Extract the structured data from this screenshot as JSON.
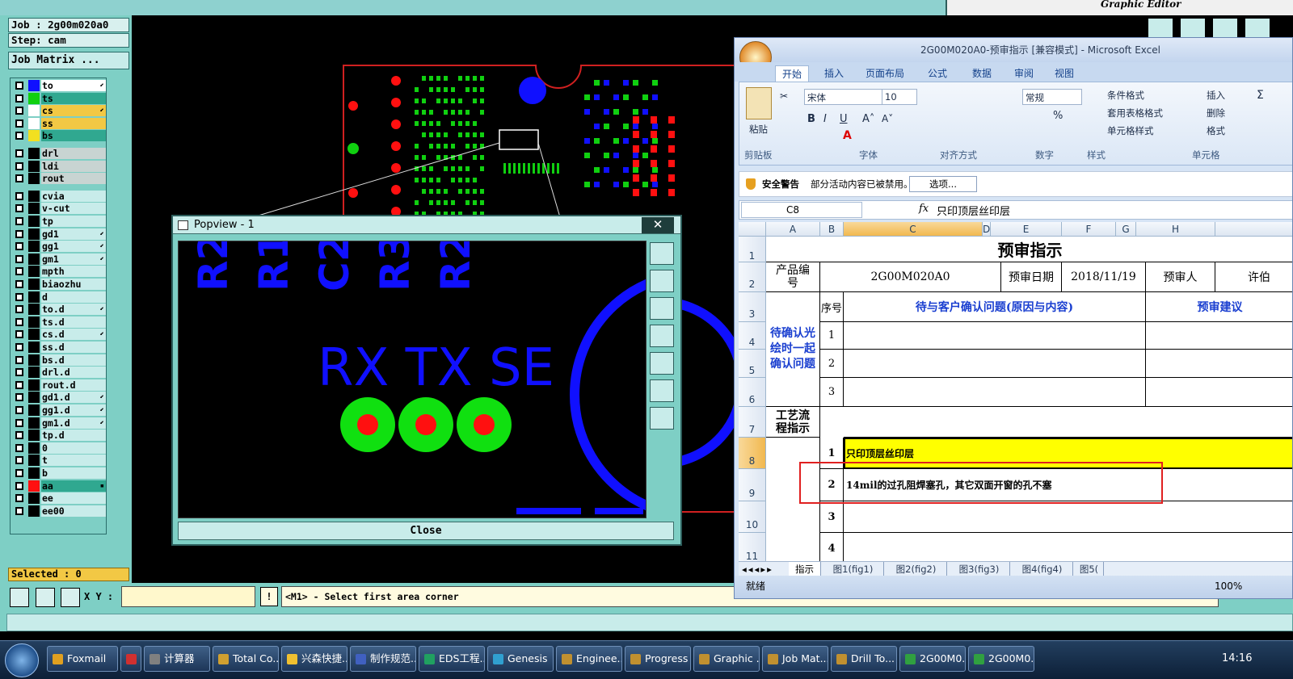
{
  "genesis": {
    "job_label": "Job : 2g00m020a0",
    "step_label": "Step: cam",
    "job_matrix_button": "Job Matrix ...",
    "graphic_editor_title": "Graphic Editor",
    "layers": [
      {
        "name": "to",
        "color": "#1010ff",
        "bg": "#ffffff",
        "flag": "⬋"
      },
      {
        "name": "ts",
        "color": "#10d010",
        "bg": "#30a890",
        "flag": ""
      },
      {
        "name": "cs",
        "color": "#ffffff",
        "bg": "#f2c844",
        "flag": "⬋"
      },
      {
        "name": "ss",
        "color": "#ffffff",
        "bg": "#f2c844",
        "flag": ""
      },
      {
        "name": "bs",
        "color": "#f2e020",
        "bg": "#30a890",
        "flag": ""
      },
      {
        "name": "drl",
        "color": "#000000",
        "bg": "#c8d4d2",
        "flag": ""
      },
      {
        "name": "ldi",
        "color": "#000000",
        "bg": "#c8d4d2",
        "flag": ""
      },
      {
        "name": "rout",
        "color": "#000000",
        "bg": "#c8d4d2",
        "flag": ""
      },
      {
        "name": "cvia",
        "color": "#000000",
        "bg": "#c8ecea",
        "flag": ""
      },
      {
        "name": "v-cut",
        "color": "#000000",
        "bg": "#c8ecea",
        "flag": ""
      },
      {
        "name": "tp",
        "color": "#000000",
        "bg": "#c8ecea",
        "flag": ""
      },
      {
        "name": "gd1",
        "color": "#000000",
        "bg": "#c8ecea",
        "flag": "⬋"
      },
      {
        "name": "gg1",
        "color": "#000000",
        "bg": "#c8ecea",
        "flag": "⬋"
      },
      {
        "name": "gm1",
        "color": "#000000",
        "bg": "#c8ecea",
        "flag": "⬋"
      },
      {
        "name": "mpth",
        "color": "#000000",
        "bg": "#c8ecea",
        "flag": ""
      },
      {
        "name": "biaozhu",
        "color": "#000000",
        "bg": "#c8ecea",
        "flag": ""
      },
      {
        "name": "d",
        "color": "#000000",
        "bg": "#c8ecea",
        "flag": ""
      },
      {
        "name": "to.d",
        "color": "#000000",
        "bg": "#c8ecea",
        "flag": "⬋"
      },
      {
        "name": "ts.d",
        "color": "#000000",
        "bg": "#c8ecea",
        "flag": ""
      },
      {
        "name": "cs.d",
        "color": "#000000",
        "bg": "#c8ecea",
        "flag": "⬋"
      },
      {
        "name": "ss.d",
        "color": "#000000",
        "bg": "#c8ecea",
        "flag": ""
      },
      {
        "name": "bs.d",
        "color": "#000000",
        "bg": "#c8ecea",
        "flag": ""
      },
      {
        "name": "drl.d",
        "color": "#000000",
        "bg": "#c8ecea",
        "flag": ""
      },
      {
        "name": "rout.d",
        "color": "#000000",
        "bg": "#c8ecea",
        "flag": ""
      },
      {
        "name": "gd1.d",
        "color": "#000000",
        "bg": "#c8ecea",
        "flag": "⬋"
      },
      {
        "name": "gg1.d",
        "color": "#000000",
        "bg": "#c8ecea",
        "flag": "⬋"
      },
      {
        "name": "gm1.d",
        "color": "#000000",
        "bg": "#c8ecea",
        "flag": "⬋"
      },
      {
        "name": "tp.d",
        "color": "#000000",
        "bg": "#c8ecea",
        "flag": ""
      },
      {
        "name": "0",
        "color": "#000000",
        "bg": "#c8ecea",
        "flag": ""
      },
      {
        "name": "t",
        "color": "#000000",
        "bg": "#c8ecea",
        "flag": ""
      },
      {
        "name": "b",
        "color": "#000000",
        "bg": "#c8ecea",
        "flag": ""
      },
      {
        "name": "aa",
        "color": "#ff1010",
        "bg": "#30a890",
        "flag": "▪"
      },
      {
        "name": "ee",
        "color": "#000000",
        "bg": "#c8ecea",
        "flag": ""
      },
      {
        "name": "ee00",
        "color": "#000000",
        "bg": "#c8ecea",
        "flag": ""
      }
    ],
    "selected_label": "Selected : 0",
    "xy_label": "X Y :",
    "xy_value": "",
    "message": "<M1> - Select first area corner"
  },
  "popview": {
    "title": "Popview - 1",
    "close_label": "Close",
    "silkscreen_text": "RX TX SE",
    "top_labels": [
      "R2",
      "R1",
      "C2",
      "R3",
      "R2"
    ]
  },
  "excel": {
    "title": "2G00M020A0-预审指示 [兼容模式] - Microsoft Excel",
    "tabs": [
      "开始",
      "插入",
      "页面布局",
      "公式",
      "数据",
      "审阅",
      "视图"
    ],
    "ribbon": {
      "font_name": "宋体",
      "font_size": "10",
      "number_format": "常规",
      "paste_label": "粘贴",
      "cond_format": "条件格式",
      "table_format": "套用表格格式",
      "cell_style": "单元格样式",
      "insert": "插入",
      "delete": "删除",
      "format": "格式",
      "groups": [
        "剪贴板",
        "字体",
        "对齐方式",
        "数字",
        "样式",
        "单元格"
      ]
    },
    "security_title": "安全警告",
    "security_msg": "部分活动内容已被禁用。",
    "security_button": "选项...",
    "name_box": "C8",
    "formula_value": "只印顶层丝印层",
    "columns": [
      "A",
      "B",
      "C",
      "D",
      "E",
      "F",
      "G",
      "H"
    ],
    "rows": [
      "1",
      "2",
      "3",
      "4",
      "5",
      "6",
      "7",
      "8",
      "9",
      "10",
      "11"
    ],
    "sheet": {
      "title": "预审指示",
      "product_label": "产品编号",
      "product_value": "2G00M020A0",
      "date_label": "预审日期",
      "date_value": "2018/11/19",
      "reviewer_label": "预审人",
      "reviewer_value": "许伯",
      "seq_header": "序号",
      "issue_header": "待与客户确认问题(原因与内容)",
      "advice_header": "预审建议",
      "pending_label": "待确认光绘时一起确认问题",
      "process_label": "工艺流程指示",
      "issue_nums": [
        "1",
        "2",
        "3"
      ],
      "process_items": [
        {
          "num": "1",
          "text": "只印顶层丝印层"
        },
        {
          "num": "2",
          "text": "14mil的过孔阻焊塞孔，其它双面开窗的孔不塞"
        },
        {
          "num": "3",
          "text": ""
        },
        {
          "num": "4",
          "text": ""
        }
      ]
    },
    "sheet_tabs": [
      "指示",
      "图1(fig1)",
      "图2(fig2)",
      "图3(fig3)",
      "图4(fig4)",
      "图5("
    ],
    "status": "就绪",
    "zoom": "100%"
  },
  "taskbar": {
    "items": [
      "Foxmail",
      "",
      "计算器",
      "Total Co...",
      "兴森快捷...",
      "制作规范...",
      "EDS工程...",
      "Genesis",
      "Enginee...",
      "Progress",
      "Graphic ...",
      "Job Mat...",
      "Drill To...",
      "2G00M0...",
      "2G00M0..."
    ],
    "clock": "14:16"
  },
  "colors": {
    "accent_teal": "#7ecfc5",
    "highlight_yellow": "#ffff00",
    "pcb_green": "#10d010",
    "pcb_blue": "#1010ff",
    "pcb_red": "#ff1010"
  }
}
